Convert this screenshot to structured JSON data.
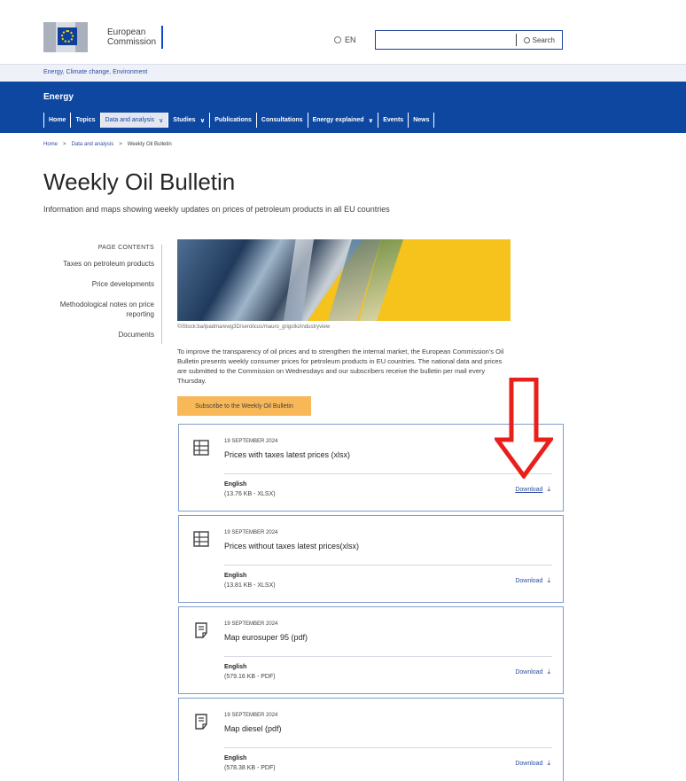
{
  "header": {
    "logo_line1": "European",
    "logo_line2": "Commission",
    "language": "EN",
    "search_value": "",
    "search_label": "Search"
  },
  "topnav": {
    "label": "Energy, Climate change, Environment"
  },
  "site": {
    "name": "Energy"
  },
  "menu": [
    {
      "label": "Home",
      "dropdown": false
    },
    {
      "label": "Topics",
      "dropdown": false
    },
    {
      "label": "Data and analysis",
      "dropdown": true,
      "active": true
    },
    {
      "label": "Studies",
      "dropdown": true
    },
    {
      "label": "Publications",
      "dropdown": false
    },
    {
      "label": "Consultations",
      "dropdown": false
    },
    {
      "label": "Energy explained",
      "dropdown": true
    },
    {
      "label": "Events",
      "dropdown": false
    },
    {
      "label": "News",
      "dropdown": false
    }
  ],
  "breadcrumb": {
    "home": "Home",
    "section": "Data and analysis",
    "current": "Weekly Oil Bulletin"
  },
  "page": {
    "title": "Weekly Oil Bulletin",
    "intro": "Information and maps showing weekly updates on prices of petroleum products in all EU countries"
  },
  "toc": {
    "heading": "PAGE CONTENTS",
    "items": [
      "Taxes on petroleum products",
      "Price developments",
      "Methodological notes on price reporting",
      "Documents"
    ]
  },
  "hero": {
    "credit": "©iStock:ba/ipadma/ewg3D/serolicus/mauro_grigollo/industryview",
    "accent_color": "#f6c21c"
  },
  "body_text": "To improve the transparency of oil prices and to strengthen the internal market, the European Commission's Oil Bulletin presents weekly consumer prices for petroleum products in EU countries. The national data and prices are submitted to the Commission on Wednesdays and our subscribers receive the bulletin per mail every Thursday.",
  "subscribe_label": "Subscribe to the Weekly Oil Bulletin",
  "documents": [
    {
      "icon": "spreadsheet-icon",
      "date": "19 SEPTEMBER 2024",
      "title": "Prices with taxes latest prices (xlsx)",
      "language": "English",
      "size": "(13.76 KB - XLSX)",
      "download": "Download"
    },
    {
      "icon": "spreadsheet-icon",
      "date": "19 SEPTEMBER 2024",
      "title": "Prices without taxes latest prices(xlsx)",
      "language": "English",
      "size": "(13.81 KB - XLSX)",
      "download": "Download"
    },
    {
      "icon": "document-icon",
      "date": "19 SEPTEMBER 2024",
      "title": "Map eurosuper 95 (pdf)",
      "language": "English",
      "size": "(579.16 KB - PDF)",
      "download": "Download"
    },
    {
      "icon": "document-icon",
      "date": "19 SEPTEMBER 2024",
      "title": "Map diesel (pdf)",
      "language": "English",
      "size": "(578.38 KB - PDF)",
      "download": "Download"
    }
  ],
  "colors": {
    "brand_blue": "#0e47a0",
    "link": "#2b4ea0",
    "annotation_red": "#e8201c"
  }
}
